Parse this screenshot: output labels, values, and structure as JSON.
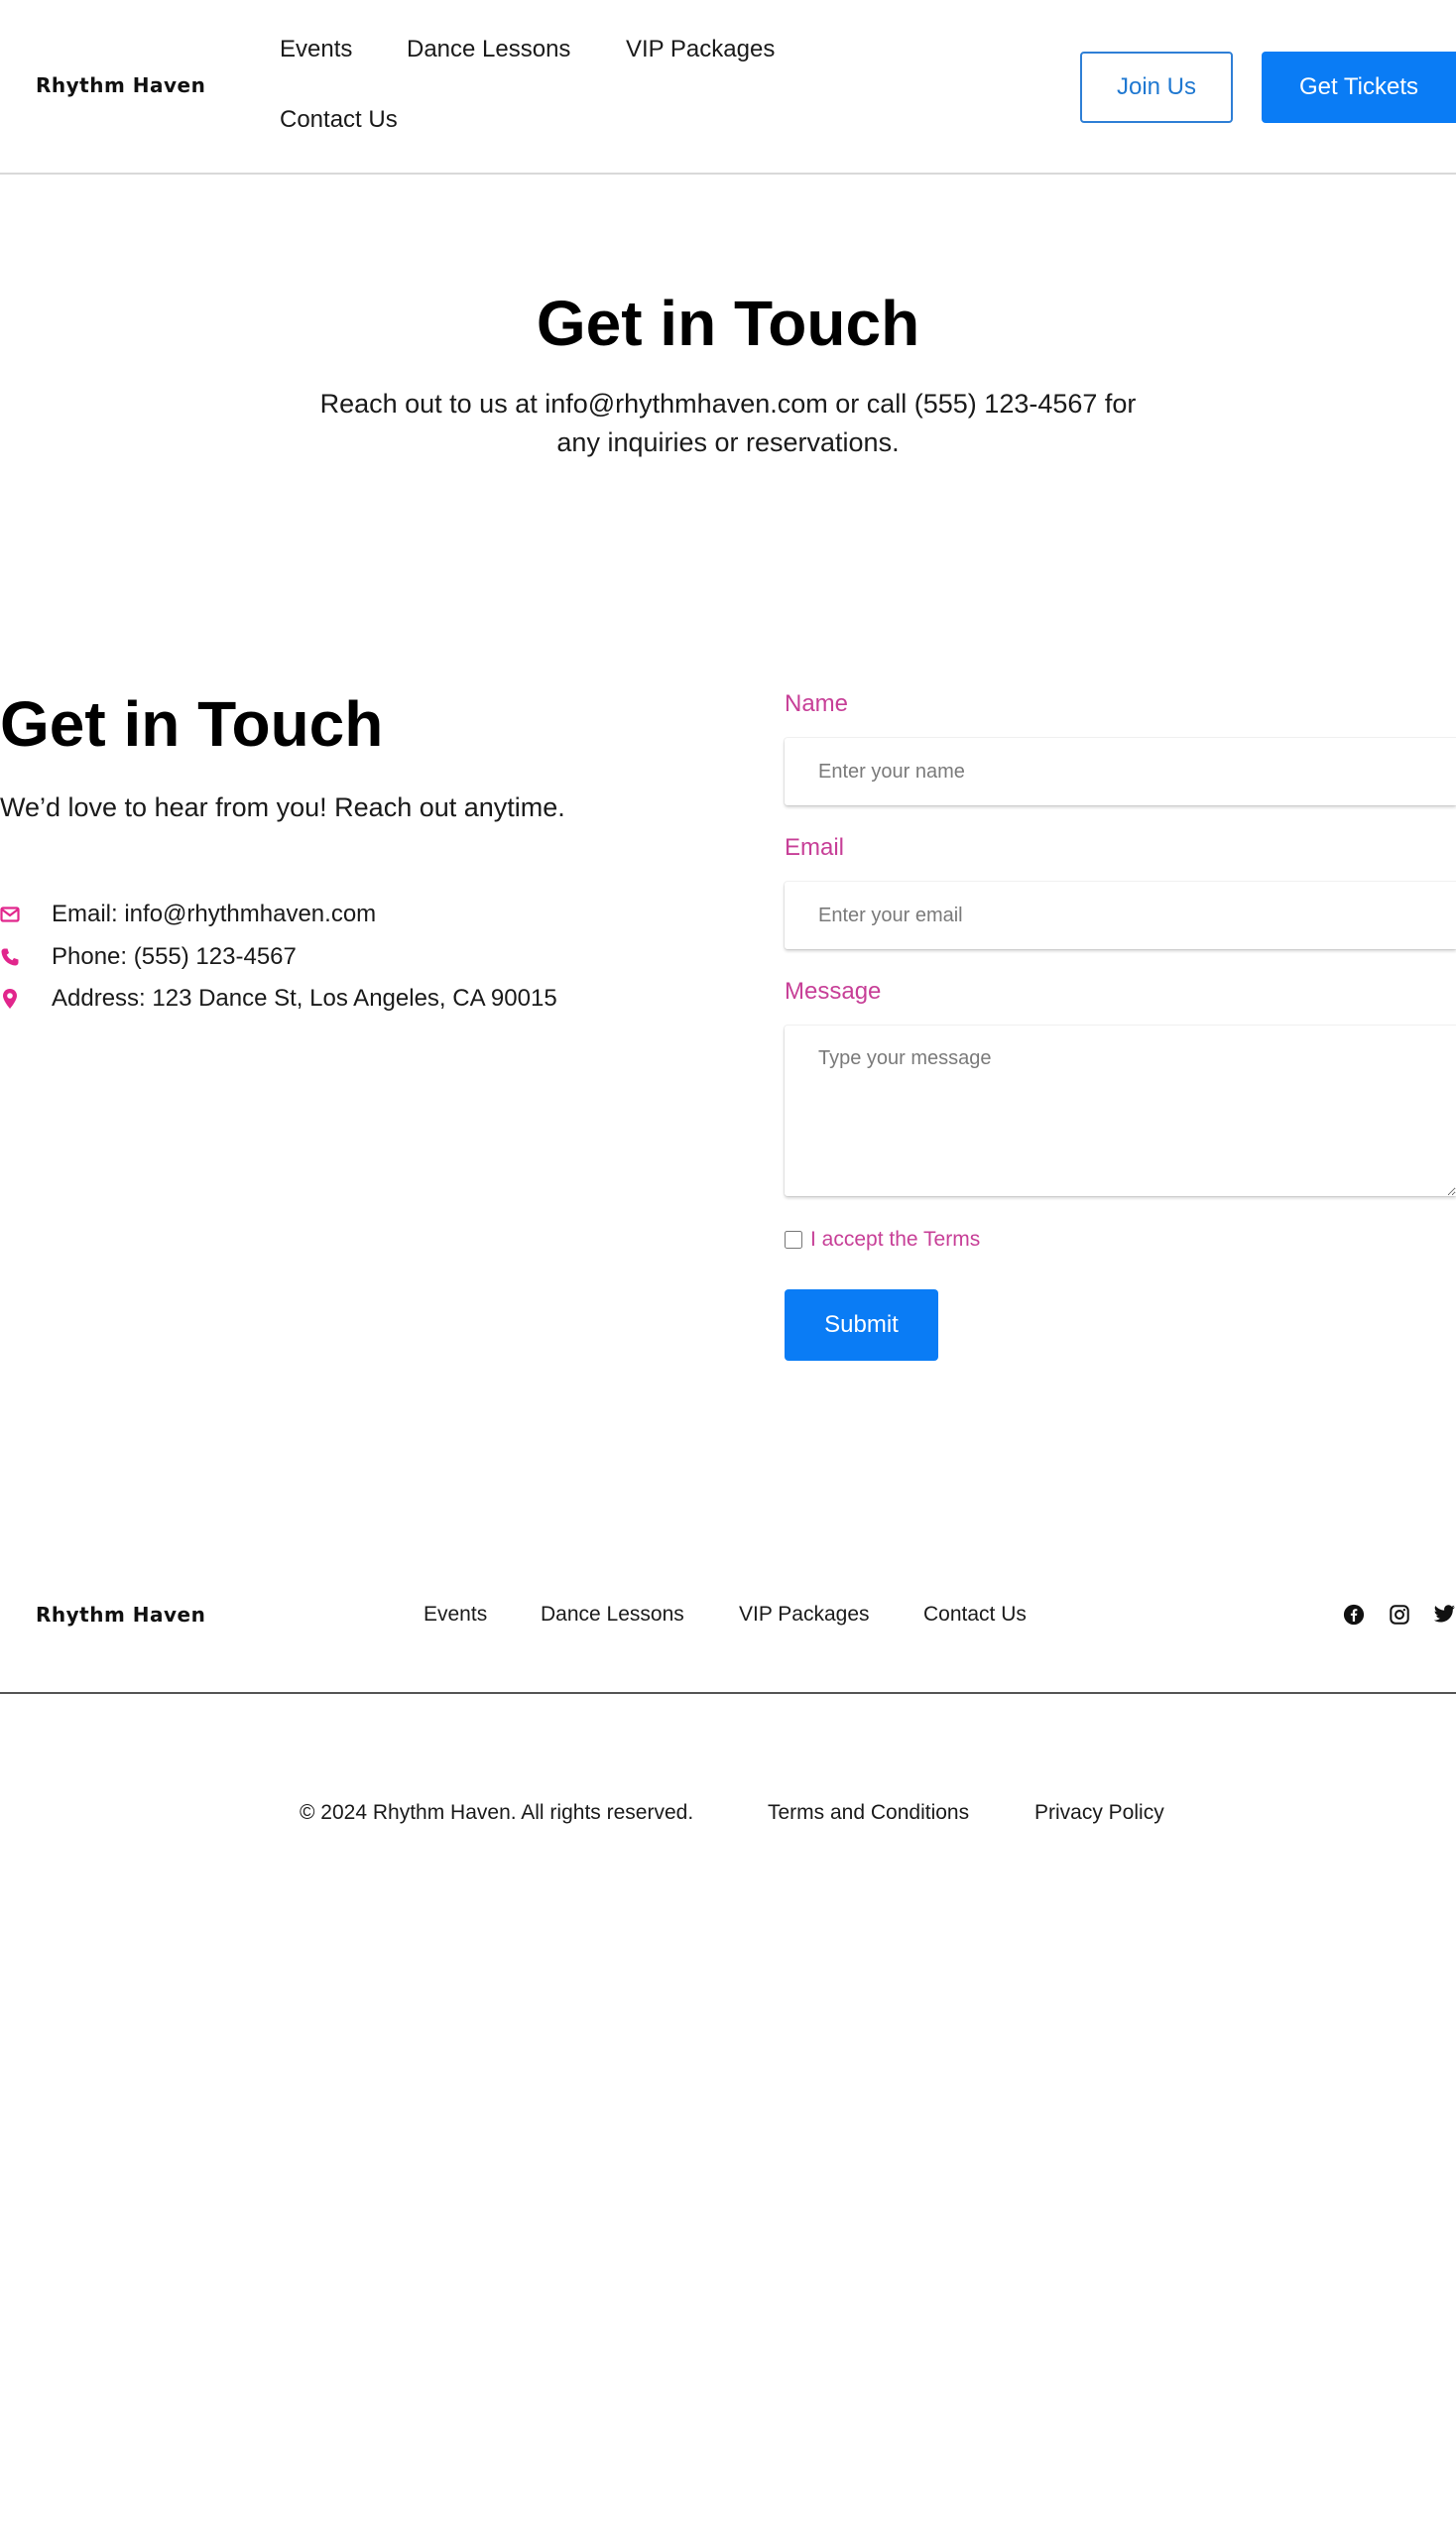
{
  "brand": {
    "name": "Rhythm Haven"
  },
  "header": {
    "nav": [
      "Events",
      "Dance Lessons",
      "VIP Packages",
      "Contact Us"
    ],
    "join_label": "Join Us",
    "tickets_label": "Get Tickets"
  },
  "hero": {
    "title": "Get in Touch",
    "subtitle": "Reach out to us at info@rhythmhaven.com or call (555) 123-4567 for any inquiries or reservations."
  },
  "contact": {
    "title": "Get in Touch",
    "subtitle": "We’d love to hear from you! Reach out anytime.",
    "items": [
      {
        "icon": "envelope-icon",
        "text": "Email: info@rhythmhaven.com"
      },
      {
        "icon": "phone-icon",
        "text": "Phone: (555) 123-4567"
      },
      {
        "icon": "map-pin-icon",
        "text": "Address: 123 Dance St, Los Angeles, CA 90015"
      }
    ],
    "accent_color": "#e1268c"
  },
  "form": {
    "name_label": "Name",
    "name_placeholder": "Enter your name",
    "name_value": "",
    "email_label": "Email",
    "email_placeholder": "Enter your email",
    "email_value": "",
    "message_label": "Message",
    "message_placeholder": "Type your message",
    "message_value": "",
    "terms_label": "I accept the Terms",
    "terms_checked": false,
    "submit_label": "Submit",
    "label_color": "#c73f97"
  },
  "footer": {
    "nav": [
      "Events",
      "Dance Lessons",
      "VIP Packages",
      "Contact Us"
    ],
    "social": [
      "facebook-icon",
      "instagram-icon",
      "twitter-icon"
    ],
    "copyright": "© 2024 Rhythm Haven. All rights reserved.",
    "terms_link": "Terms and Conditions",
    "privacy_link": "Privacy Policy"
  },
  "colors": {
    "primary": "#0a7cf5",
    "outline": "#1f78d1",
    "accent": "#e1268c"
  }
}
